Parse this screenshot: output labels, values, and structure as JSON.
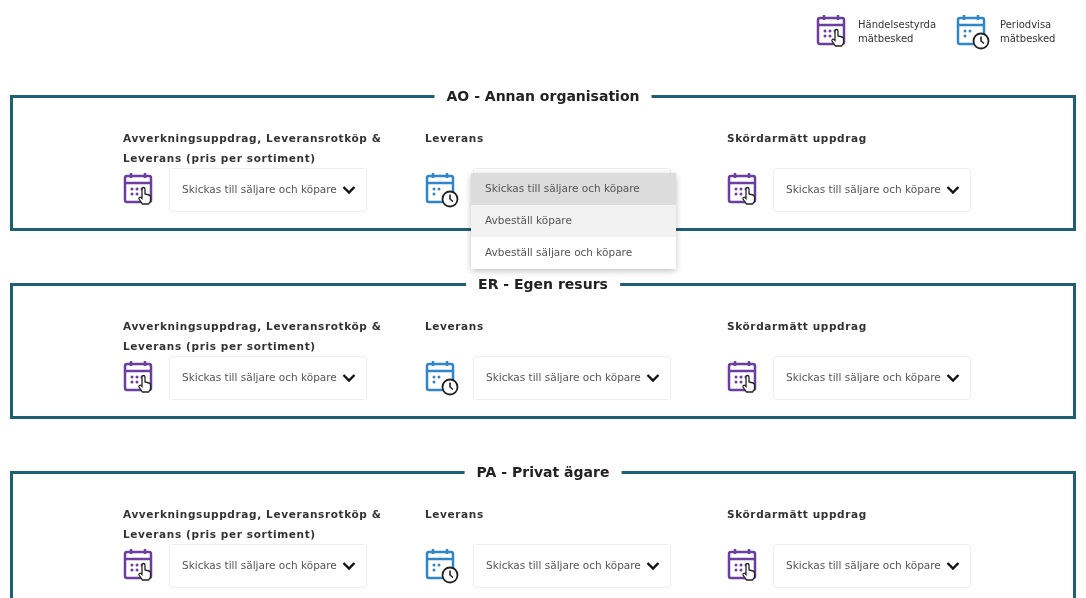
{
  "legend": [
    {
      "kind": "event",
      "label": "Händelsestyrda mätbesked"
    },
    {
      "kind": "periodic",
      "label": "Periodvisa mätbesked"
    }
  ],
  "sections": [
    {
      "title": "AO - Annan organisation",
      "fields": [
        {
          "label": "Avverkningsuppdrag, Leveransrotköp & Leverans (pris per sortiment)",
          "kind": "event",
          "value": "Skickas till säljare och köpare"
        },
        {
          "label": "Leverans",
          "kind": "periodic",
          "expanded": true,
          "options": [
            {
              "label": "Skickas till säljare och köpare",
              "selected": true,
              "hovered": false
            },
            {
              "label": "Avbeställ köpare",
              "selected": false,
              "hovered": true
            },
            {
              "label": "Avbeställ säljare och köpare",
              "selected": false,
              "hovered": false
            }
          ]
        },
        {
          "label": "Skördarmätt uppdrag",
          "kind": "event",
          "value": "Skickas till säljare och köpare"
        }
      ]
    },
    {
      "title": "ER - Egen resurs",
      "fields": [
        {
          "label": "Avverkningsuppdrag, Leveransrotköp & Leverans (pris per sortiment)",
          "kind": "event",
          "value": "Skickas till säljare och köpare"
        },
        {
          "label": "Leverans",
          "kind": "periodic",
          "value": "Skickas till säljare och köpare"
        },
        {
          "label": "Skördarmätt uppdrag",
          "kind": "event",
          "value": "Skickas till säljare och köpare"
        }
      ]
    },
    {
      "title": "PA - Privat ägare",
      "fields": [
        {
          "label": "Avverkningsuppdrag, Leveransrotköp & Leverans (pris per sortiment)",
          "kind": "event",
          "value": "Skickas till säljare och köpare"
        },
        {
          "label": "Leverans",
          "kind": "periodic",
          "value": "Skickas till säljare och köpare"
        },
        {
          "label": "Skördarmätt uppdrag",
          "kind": "event",
          "value": "Skickas till säljare och köpare"
        }
      ]
    }
  ]
}
